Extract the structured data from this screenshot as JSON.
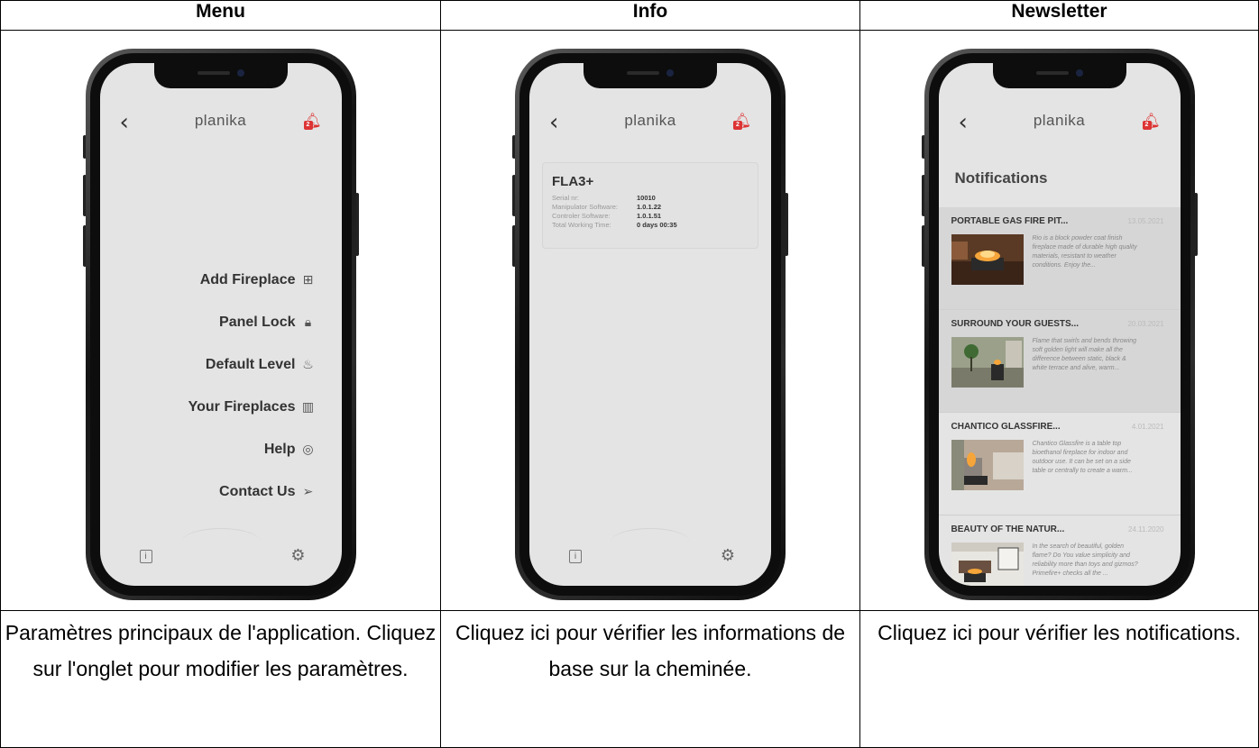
{
  "headers": [
    "Menu",
    "Info",
    "Newsletter"
  ],
  "captions": [
    "Paramètres principaux de l'application. Cliquez sur l'onglet pour modifier les paramètres.",
    "Cliquez ici pour vérifier les informations de base sur la cheminée.",
    "Cliquez ici pour vérifier les notifications."
  ],
  "app": {
    "brand": "planika",
    "back_icon": "chevron-left-icon",
    "bell_icon": "bell-icon",
    "bell_badge": "2",
    "accent": "#d33333",
    "info_icon": "info-icon",
    "settings_icon": "gear-icon"
  },
  "menu": {
    "items": [
      {
        "label": "Add Fireplace",
        "icon": "plus-square-icon"
      },
      {
        "label": "Panel Lock",
        "icon": "lock-icon"
      },
      {
        "label": "Default Level",
        "icon": "flame-icon"
      },
      {
        "label": "Your Fireplaces",
        "icon": "fireplace-icon"
      },
      {
        "label": "Help",
        "icon": "lifebuoy-icon"
      },
      {
        "label": "Contact Us",
        "icon": "send-icon"
      }
    ]
  },
  "info": {
    "title": "FLA3+",
    "rows": [
      {
        "label": "Serial nr:",
        "value": "10010"
      },
      {
        "label": "Manipulator Software:",
        "value": "1.0.1.22"
      },
      {
        "label": "Controler Software:",
        "value": "1.0.1.51"
      },
      {
        "label": "Total Working Time:",
        "value": "0 days  00:35"
      }
    ]
  },
  "newsletter": {
    "title": "Notifications",
    "items": [
      {
        "title": "PORTABLE GAS FIRE PIT...",
        "date": "13.05.2021",
        "text": "Rio is a block powder coat finish fireplace made of durable high quality materials, resistant to weather conditions. Enjoy the..."
      },
      {
        "title": "SURROUND YOUR GUESTS...",
        "date": "20.03.2021",
        "text": "Flame that swirls and bends throwing soft golden light will make all the difference between static, black & white terrace and alive, warm..."
      },
      {
        "title": "CHANTICO GLASSFIRE...",
        "date": "4.01.2021",
        "text": "Chantico Glassfire is a table top bioethanol fireplace for indoor and outdoor use. It can be set on a side table or centrally to create a warm..."
      },
      {
        "title": "BEAUTY OF THE NATUR...",
        "date": "24.11.2020",
        "text": "In the search of beautiful, golden flame? Do You value simplicity and reliability more than toys and gizmos? Primefire+ checks all the ..."
      }
    ]
  }
}
